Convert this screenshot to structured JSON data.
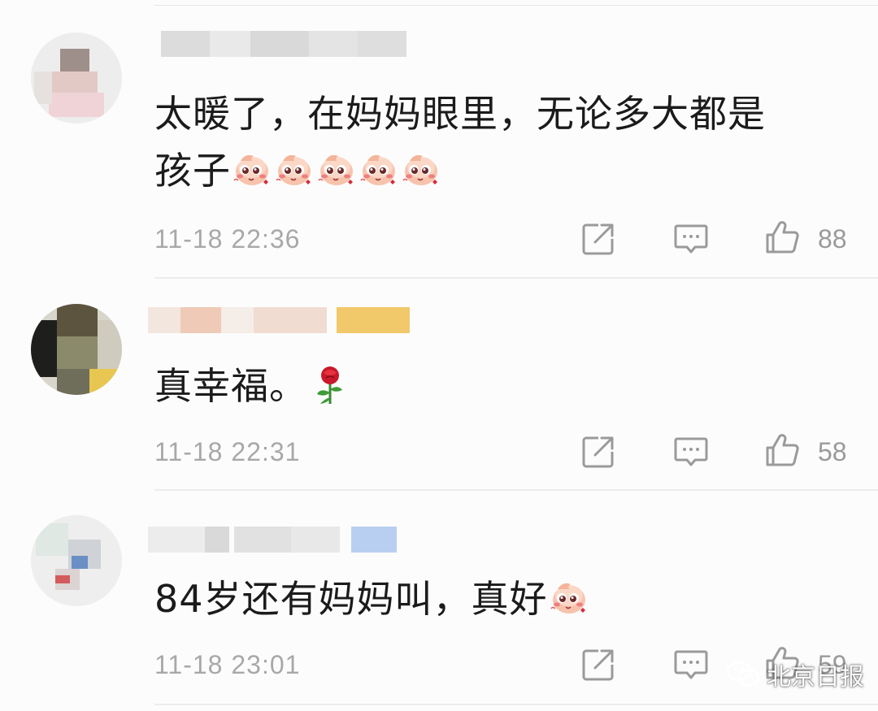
{
  "comments": [
    {
      "text_line1": "太暖了，在妈妈眼里，无论多大都是",
      "text_line2": "孩子",
      "emoji_count": 5,
      "time": "11-18 22:36",
      "likes": "88"
    },
    {
      "text": "真幸福。",
      "time": "11-18 22:31",
      "likes": "58"
    },
    {
      "text": "84岁还有妈妈叫，真好",
      "time": "11-18 23:01",
      "likes": "59"
    }
  ],
  "watermark": {
    "label": "北京日报"
  },
  "colors": {
    "text": "#1b1b1b",
    "meta": "#a8a8a8",
    "icon": "#9a9a9a",
    "divider": "#ececec"
  },
  "icons": {
    "forward": "share-box-icon",
    "comment": "comment-bubble-icon",
    "like": "thumb-up-icon",
    "emoji": "blush-face-emoji",
    "rose": "rose-emoji"
  }
}
